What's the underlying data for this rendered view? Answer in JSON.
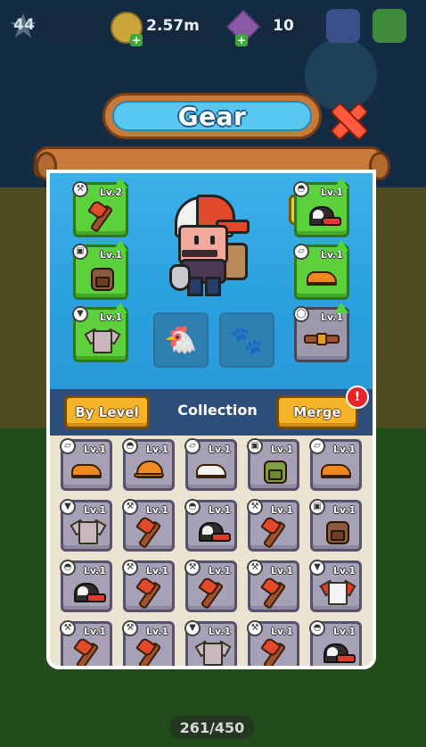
{
  "hud": {
    "player_level": "44",
    "coins": "2.57m",
    "gems": "10"
  },
  "title": "Gear",
  "equipped": {
    "left": [
      {
        "item": "axe",
        "level": "Lv.2",
        "type_icon": "axe-icon",
        "upgrade": true
      },
      {
        "item": "backpack",
        "level": "Lv.1",
        "type_icon": "backpack-icon",
        "upgrade": true
      },
      {
        "item": "shirt",
        "level": "Lv.1",
        "type_icon": "shirt-icon",
        "upgrade": true
      }
    ],
    "right": [
      {
        "item": "cap",
        "level": "Lv.1",
        "type_icon": "hat-icon",
        "upgrade": true
      },
      {
        "item": "shoe",
        "level": "Lv.1",
        "type_icon": "shoe-icon",
        "upgrade": true
      },
      {
        "item": "belt",
        "level": "Lv.1",
        "type_icon": "belt-icon",
        "upgrade": true
      }
    ],
    "pets": [
      "chicken-icon",
      "paw-icon"
    ]
  },
  "tabs": {
    "by_level": "By Level",
    "collection": "Collection",
    "merge": "Merge",
    "merge_alert": "!"
  },
  "collection": [
    {
      "item": "shoe",
      "level": "Lv.1",
      "type_icon": "shoe-icon"
    },
    {
      "item": "hardhat",
      "level": "Lv.1",
      "type_icon": "hat-icon"
    },
    {
      "item": "shoe-white",
      "level": "Lv.1",
      "type_icon": "shoe-icon"
    },
    {
      "item": "backpack-green",
      "level": "Lv.1",
      "type_icon": "backpack-icon"
    },
    {
      "item": "shoe",
      "level": "Lv.1",
      "type_icon": "shoe-icon"
    },
    {
      "item": "shirt",
      "level": "Lv.1",
      "type_icon": "shirt-icon"
    },
    {
      "item": "axe",
      "level": "Lv.1",
      "type_icon": "axe-icon"
    },
    {
      "item": "cap",
      "level": "Lv.1",
      "type_icon": "hat-icon"
    },
    {
      "item": "axe",
      "level": "Lv.1",
      "type_icon": "axe-icon"
    },
    {
      "item": "backpack",
      "level": "Lv.1",
      "type_icon": "backpack-icon"
    },
    {
      "item": "cap",
      "level": "Lv.1",
      "type_icon": "hat-icon"
    },
    {
      "item": "axe",
      "level": "Lv.1",
      "type_icon": "axe-icon"
    },
    {
      "item": "axe",
      "level": "Lv.1",
      "type_icon": "axe-icon"
    },
    {
      "item": "axe",
      "level": "Lv.1",
      "type_icon": "axe-icon"
    },
    {
      "item": "shirt-red",
      "level": "Lv.1",
      "type_icon": "shirt-icon"
    },
    {
      "item": "axe",
      "level": "Lv.1",
      "type_icon": "axe-icon"
    },
    {
      "item": "axe",
      "level": "Lv.1",
      "type_icon": "axe-icon"
    },
    {
      "item": "shirt",
      "level": "Lv.1",
      "type_icon": "shirt-icon"
    },
    {
      "item": "axe",
      "level": "Lv.1",
      "type_icon": "axe-icon"
    },
    {
      "item": "cap",
      "level": "Lv.1",
      "type_icon": "hat-icon"
    }
  ],
  "bottom": {
    "counter": "261/450"
  }
}
